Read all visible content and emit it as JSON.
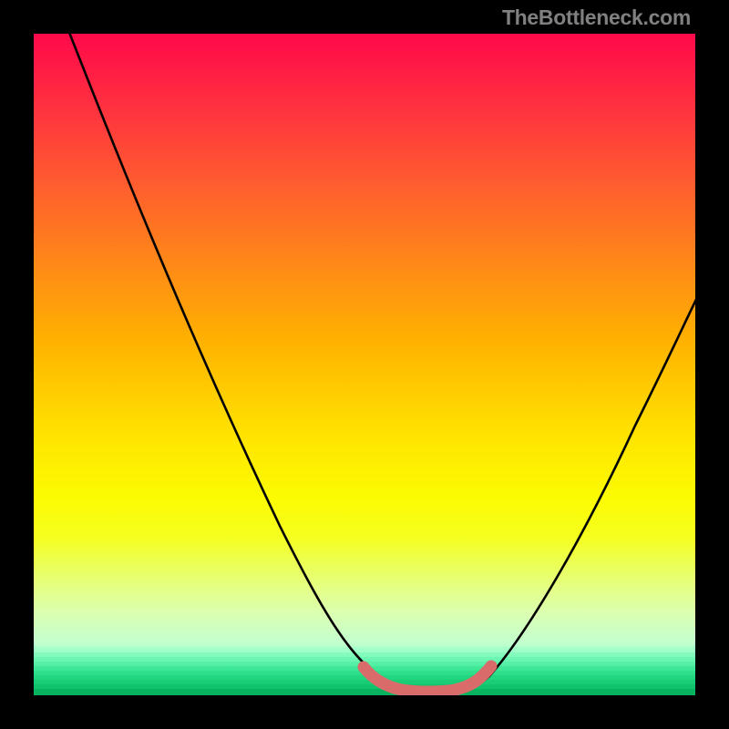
{
  "watermark": "TheBottleneck.com",
  "chart_data": {
    "type": "line",
    "title": "",
    "xlabel": "",
    "ylabel": "",
    "xlim": [
      0,
      100
    ],
    "ylim": [
      0,
      100
    ],
    "grid": false,
    "legend": false,
    "series": [
      {
        "name": "bottleneck-curve",
        "x": [
          0,
          5,
          10,
          15,
          20,
          25,
          30,
          35,
          40,
          45,
          50,
          52,
          55,
          58,
          60,
          62,
          65,
          70,
          75,
          80,
          85,
          90,
          95,
          100
        ],
        "y": [
          107,
          100,
          92,
          84,
          75,
          66,
          57,
          48,
          38,
          27,
          15,
          10,
          4,
          1,
          0.5,
          0.5,
          1,
          2,
          7,
          16,
          28,
          41,
          53,
          62
        ]
      },
      {
        "name": "trough-highlight",
        "x": [
          50,
          52,
          54,
          56,
          58,
          60,
          62,
          64,
          66
        ],
        "y": [
          3.5,
          2.2,
          1.3,
          0.8,
          0.6,
          0.6,
          0.8,
          1.3,
          2.4
        ]
      }
    ],
    "gradient_stops": [
      {
        "pos": 0.0,
        "color": "#ff0a4a"
      },
      {
        "pos": 0.3,
        "color": "#ff7720"
      },
      {
        "pos": 0.55,
        "color": "#ffd400"
      },
      {
        "pos": 0.78,
        "color": "#f5ff2a"
      },
      {
        "pos": 0.92,
        "color": "#c3ffce"
      },
      {
        "pos": 1.0,
        "color": "#14d77a"
      }
    ],
    "curve_color": "#000000",
    "trough_color": "#d96b6b"
  }
}
